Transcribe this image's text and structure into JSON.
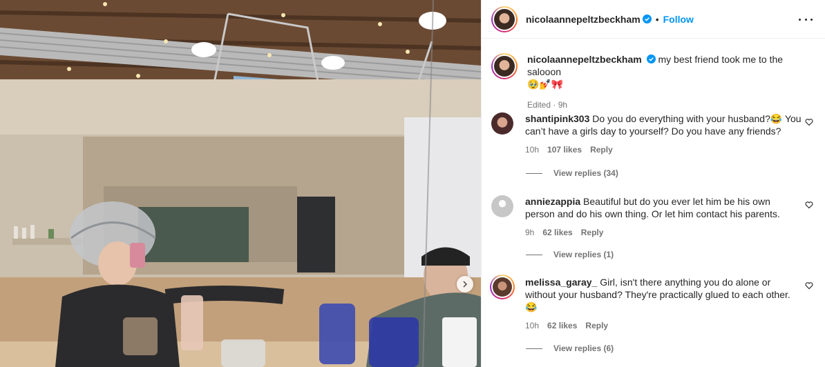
{
  "post": {
    "username": "nicolaannepeltzbeckham",
    "follow_label": "Follow",
    "separator": "•",
    "caption_text": "my best friend took me to the salooon",
    "caption_emojis": "🥹💅🎀",
    "meta": "Edited · 9h"
  },
  "comments": [
    {
      "username": "shantipink303",
      "text": "Do you do everything with your husband?😂 You can’t have a girls day to yourself? Do you have any friends?",
      "time": "10h",
      "likes": "107 likes",
      "reply": "Reply",
      "view_replies": "View replies (34)",
      "avatar_color": "#4a2a2a"
    },
    {
      "username": "anniezappia",
      "text": "Beautiful but do you ever let him be his own person and do his own thing. Or let him contact his parents.",
      "time": "9h",
      "likes": "62 likes",
      "reply": "Reply",
      "view_replies": "View replies (1)",
      "avatar_color": "#dbdbdb"
    },
    {
      "username": "melissa_garay_",
      "text": "Girl, isn't there anything you do alone or without your husband? They're practically glued to each other. 😂",
      "time": "10h",
      "likes": "62 likes",
      "reply": "Reply",
      "view_replies": "View replies (6)",
      "avatar_color": "#5b3a2e"
    }
  ],
  "colors": {
    "accent": "#0095f6",
    "verified": "#0095f6",
    "muted": "#737373"
  },
  "icons": {
    "verified": "verified-badge-icon",
    "more": "more-options-icon",
    "heart": "heart-icon",
    "next": "chevron-right-icon"
  }
}
